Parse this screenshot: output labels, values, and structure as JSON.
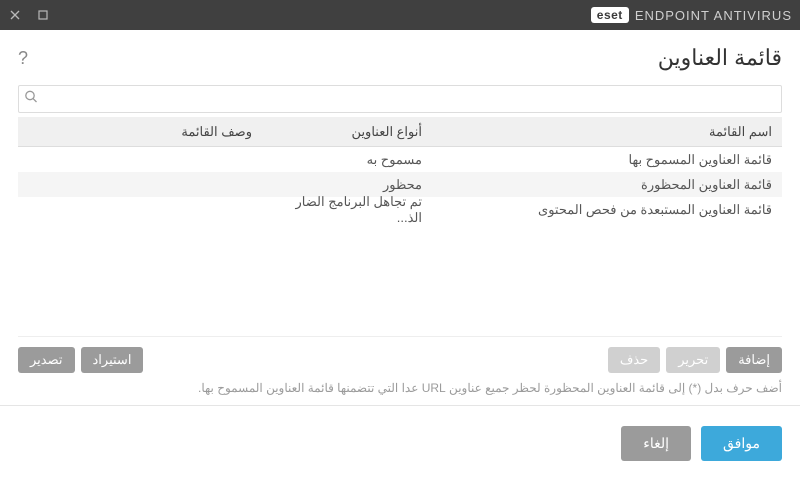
{
  "titlebar": {
    "brand": "eset",
    "product": "ENDPOINT ANTIVIRUS"
  },
  "page": {
    "title": "قائمة العناوين"
  },
  "search": {
    "placeholder": ""
  },
  "table": {
    "headers": {
      "name": "اسم القائمة",
      "type": "أنواع العناوين",
      "desc": "وصف القائمة"
    },
    "rows": [
      {
        "name": "قائمة العناوين المسموح بها",
        "type": "مسموح به",
        "desc": ""
      },
      {
        "name": "قائمة العناوين المحظورة",
        "type": "محظور",
        "desc": ""
      },
      {
        "name": "قائمة العناوين المستبعدة من فحص المحتوى",
        "type": "تم تجاهل البرنامج الضار الذ...",
        "desc": ""
      }
    ]
  },
  "actions": {
    "add": "إضافة",
    "edit": "تحرير",
    "delete": "حذف",
    "import": "استيراد",
    "export": "تصدير"
  },
  "hint": "أضف حرف بدل (*) إلى قائمة العناوين المحظورة لحظر جميع عناوين URL عدا التي تتضمنها قائمة العناوين المسموح بها.",
  "footer": {
    "ok": "موافق",
    "cancel": "إلغاء"
  }
}
